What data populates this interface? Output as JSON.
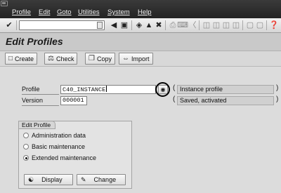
{
  "menu": {
    "items": [
      "Profile",
      "Edit",
      "Goto",
      "Utilities",
      "System",
      "Help"
    ]
  },
  "toolbar": {
    "command_field_value": "",
    "icons": [
      "enter-icon",
      "back-icon",
      "save-icon",
      "back-green-icon",
      "exit-icon",
      "cancel-icon",
      "print-icon",
      "find-icon",
      "find-next-icon",
      "first-page-icon",
      "prev-page-icon",
      "next-page-icon",
      "last-page-icon",
      "create-session-icon",
      "shortcut-icon",
      "help-icon"
    ]
  },
  "title": "Edit Profiles",
  "app_toolbar": {
    "create": "Create",
    "check": "Check",
    "copy": "Copy",
    "import": "Import"
  },
  "form": {
    "profile_label": "Profile",
    "profile_value": "C40_INSTANCE",
    "profile_desc": "Instance profile",
    "version_label": "Version",
    "version_value": "000001",
    "version_desc": "Saved, activated"
  },
  "edit_profile": {
    "title": "Edit Profile",
    "options": [
      {
        "label": "Administration data",
        "selected": false
      },
      {
        "label": "Basic maintenance",
        "selected": false
      },
      {
        "label": "Extended maintenance",
        "selected": true
      }
    ],
    "display_label": "Display",
    "change_label": "Change"
  }
}
